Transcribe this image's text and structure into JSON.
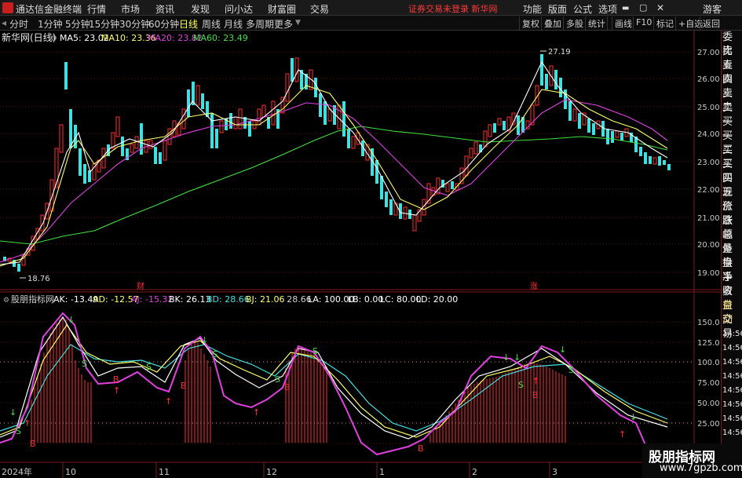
{
  "titlebar": {
    "app_name": "通达信金融终端",
    "menus": [
      "行情",
      "市场",
      "资讯",
      "发现",
      "问小达",
      "财富圈",
      "交易"
    ],
    "warning": "证券交易未登录 新华网",
    "right_menus": [
      "功能",
      "版面",
      "公式",
      "选项"
    ],
    "user": "游客"
  },
  "toolbar": {
    "periods": [
      "分时",
      "1分钟",
      "5分钟",
      "15分钟",
      "30分钟",
      "60分钟",
      "日线",
      "周线",
      "月线",
      "多周期",
      "更多"
    ],
    "active_period": "日线",
    "right_buttons": [
      "复权",
      "叠加",
      "多股",
      "统计",
      "画线",
      "F10",
      "标记",
      "+自选",
      "返回"
    ]
  },
  "main_chart": {
    "stock_title": "新华网(日线)",
    "ma_legend": [
      {
        "label": "MA5: 23.02",
        "color": "#ffffff"
      },
      {
        "label": "MA10: 23.36",
        "color": "#ffff66"
      },
      {
        "label": "MA20: 23.82",
        "color": "#e040e0"
      },
      {
        "label": "MA60: 23.49",
        "color": "#40e040"
      }
    ],
    "y_ticks": [
      "27.00",
      "26.00",
      "25.00",
      "24.00",
      "23.00",
      "22.00",
      "21.00",
      "20.00",
      "19.00"
    ],
    "high_label": "27.19",
    "low_label": "18.76",
    "markers": [
      "财",
      "涨"
    ]
  },
  "indicator": {
    "legend": [
      {
        "label": "股朋指标网",
        "color": "#cfcfcf"
      },
      {
        "label": "AK: -13.49",
        "color": "#ffffff"
      },
      {
        "label": "AD: -12.57",
        "color": "#ffff66"
      },
      {
        "label": "AJ: -15.32",
        "color": "#e040e0"
      },
      {
        "label": "BK: 26.13",
        "color": "#ffffff"
      },
      {
        "label": "BD: 28.66",
        "color": "#40e0e0"
      },
      {
        "label": "BJ: 21.06",
        "color": "#ffff66"
      },
      {
        "label": ": 28.66",
        "color": "#cfcfcf"
      },
      {
        "label": "LA: 100.00",
        "color": "#ffffff"
      },
      {
        "label": "LB: 0.00",
        "color": "#ffffff"
      },
      {
        "label": "LC: 80.00",
        "color": "#ffffff"
      },
      {
        "label": "LD: 20.00",
        "color": "#ffffff"
      }
    ],
    "y_ticks": [
      "150.0",
      "125.0",
      "100.0",
      "75.00",
      "50.00",
      "25.00"
    ]
  },
  "x_axis": {
    "labels": [
      "2024年",
      "10",
      "11",
      "12",
      "1",
      "2",
      "3"
    ]
  },
  "sidebar": {
    "items": [
      "委比",
      "卖五",
      "卖四",
      "卖三",
      "卖二",
      "卖一",
      "买一",
      "买二",
      "买三",
      "买四",
      "买五",
      "现价",
      "涨跌",
      "涨幅",
      "总量",
      "外盘",
      "换手",
      "净资",
      "收益",
      "自动",
      "交易",
      "14:56",
      "14:56",
      "14:56",
      "14:56",
      "14:56",
      "14:56",
      "14:56",
      "14:56"
    ]
  },
  "watermark": {
    "site_name": "股朋指标网",
    "site_url": "www.7gpzb.com"
  }
}
